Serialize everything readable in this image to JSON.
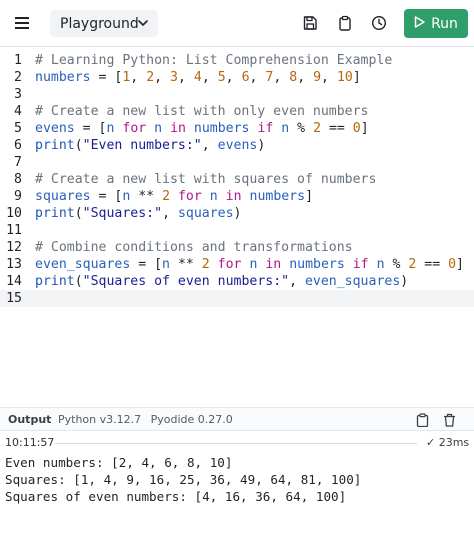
{
  "toolbar": {
    "menu_icon": "hamburger-menu-icon",
    "file_label": "Playground",
    "run_label": "Run",
    "colors": {
      "run_button": "#2f9e6a",
      "run_text": "#ffffff"
    }
  },
  "editor": {
    "lines": [
      {
        "n": "1",
        "tokens": [
          {
            "t": "# Learning Python: List Comprehension Example",
            "c": "comment"
          }
        ]
      },
      {
        "n": "2",
        "tokens": [
          {
            "t": "numbers",
            "c": "var"
          },
          {
            "t": " = [",
            "c": "op"
          },
          {
            "t": "1",
            "c": "num"
          },
          {
            "t": ", ",
            "c": "op"
          },
          {
            "t": "2",
            "c": "num"
          },
          {
            "t": ", ",
            "c": "op"
          },
          {
            "t": "3",
            "c": "num"
          },
          {
            "t": ", ",
            "c": "op"
          },
          {
            "t": "4",
            "c": "num"
          },
          {
            "t": ", ",
            "c": "op"
          },
          {
            "t": "5",
            "c": "num"
          },
          {
            "t": ", ",
            "c": "op"
          },
          {
            "t": "6",
            "c": "num"
          },
          {
            "t": ", ",
            "c": "op"
          },
          {
            "t": "7",
            "c": "num"
          },
          {
            "t": ", ",
            "c": "op"
          },
          {
            "t": "8",
            "c": "num"
          },
          {
            "t": ", ",
            "c": "op"
          },
          {
            "t": "9",
            "c": "num"
          },
          {
            "t": ", ",
            "c": "op"
          },
          {
            "t": "10",
            "c": "num"
          },
          {
            "t": "]",
            "c": "op"
          }
        ]
      },
      {
        "n": "3",
        "tokens": []
      },
      {
        "n": "4",
        "tokens": [
          {
            "t": "# Create a new list with only even numbers",
            "c": "comment"
          }
        ]
      },
      {
        "n": "5",
        "tokens": [
          {
            "t": "evens",
            "c": "var"
          },
          {
            "t": " = [",
            "c": "op"
          },
          {
            "t": "n",
            "c": "var"
          },
          {
            "t": " ",
            "c": "op"
          },
          {
            "t": "for",
            "c": "kw"
          },
          {
            "t": " ",
            "c": "op"
          },
          {
            "t": "n",
            "c": "var"
          },
          {
            "t": " ",
            "c": "op"
          },
          {
            "t": "in",
            "c": "kw"
          },
          {
            "t": " ",
            "c": "op"
          },
          {
            "t": "numbers",
            "c": "var"
          },
          {
            "t": " ",
            "c": "op"
          },
          {
            "t": "if",
            "c": "kw"
          },
          {
            "t": " ",
            "c": "op"
          },
          {
            "t": "n",
            "c": "var"
          },
          {
            "t": " % ",
            "c": "op"
          },
          {
            "t": "2",
            "c": "num"
          },
          {
            "t": " == ",
            "c": "op"
          },
          {
            "t": "0",
            "c": "num"
          },
          {
            "t": "]",
            "c": "op"
          }
        ]
      },
      {
        "n": "6",
        "tokens": [
          {
            "t": "print",
            "c": "fn"
          },
          {
            "t": "(",
            "c": "op"
          },
          {
            "t": "\"Even numbers:\"",
            "c": "str"
          },
          {
            "t": ", ",
            "c": "op"
          },
          {
            "t": "evens",
            "c": "var"
          },
          {
            "t": ")",
            "c": "op"
          }
        ]
      },
      {
        "n": "7",
        "tokens": []
      },
      {
        "n": "8",
        "tokens": [
          {
            "t": "# Create a new list with squares of numbers",
            "c": "comment"
          }
        ]
      },
      {
        "n": "9",
        "tokens": [
          {
            "t": "squares",
            "c": "var"
          },
          {
            "t": " = [",
            "c": "op"
          },
          {
            "t": "n",
            "c": "var"
          },
          {
            "t": " ** ",
            "c": "op"
          },
          {
            "t": "2",
            "c": "num"
          },
          {
            "t": " ",
            "c": "op"
          },
          {
            "t": "for",
            "c": "kw"
          },
          {
            "t": " ",
            "c": "op"
          },
          {
            "t": "n",
            "c": "var"
          },
          {
            "t": " ",
            "c": "op"
          },
          {
            "t": "in",
            "c": "kw"
          },
          {
            "t": " ",
            "c": "op"
          },
          {
            "t": "numbers",
            "c": "var"
          },
          {
            "t": "]",
            "c": "op"
          }
        ]
      },
      {
        "n": "10",
        "tokens": [
          {
            "t": "print",
            "c": "fn"
          },
          {
            "t": "(",
            "c": "op"
          },
          {
            "t": "\"Squares:\"",
            "c": "str"
          },
          {
            "t": ", ",
            "c": "op"
          },
          {
            "t": "squares",
            "c": "var"
          },
          {
            "t": ")",
            "c": "op"
          }
        ]
      },
      {
        "n": "11",
        "tokens": []
      },
      {
        "n": "12",
        "tokens": [
          {
            "t": "# Combine conditions and transformations",
            "c": "comment"
          }
        ]
      },
      {
        "n": "13",
        "tokens": [
          {
            "t": "even_squares",
            "c": "var"
          },
          {
            "t": " = [",
            "c": "op"
          },
          {
            "t": "n",
            "c": "var"
          },
          {
            "t": " ** ",
            "c": "op"
          },
          {
            "t": "2",
            "c": "num"
          },
          {
            "t": " ",
            "c": "op"
          },
          {
            "t": "for",
            "c": "kw"
          },
          {
            "t": " ",
            "c": "op"
          },
          {
            "t": "n",
            "c": "var"
          },
          {
            "t": " ",
            "c": "op"
          },
          {
            "t": "in",
            "c": "kw"
          },
          {
            "t": " ",
            "c": "op"
          },
          {
            "t": "numbers",
            "c": "var"
          },
          {
            "t": " ",
            "c": "op"
          },
          {
            "t": "if",
            "c": "kw"
          },
          {
            "t": " ",
            "c": "op"
          },
          {
            "t": "n",
            "c": "var"
          },
          {
            "t": " % ",
            "c": "op"
          },
          {
            "t": "2",
            "c": "num"
          },
          {
            "t": " == ",
            "c": "op"
          },
          {
            "t": "0",
            "c": "num"
          },
          {
            "t": "]",
            "c": "op"
          }
        ]
      },
      {
        "n": "14",
        "tokens": [
          {
            "t": "print",
            "c": "fn"
          },
          {
            "t": "(",
            "c": "op"
          },
          {
            "t": "\"Squares of even numbers:\"",
            "c": "str"
          },
          {
            "t": ", ",
            "c": "op"
          },
          {
            "t": "even_squares",
            "c": "var"
          },
          {
            "t": ")",
            "c": "op"
          }
        ]
      },
      {
        "n": "15",
        "tokens": [],
        "active": true
      }
    ]
  },
  "output": {
    "title": "Output",
    "python_version": "Python v3.12.7",
    "pyodide_version": "Pyodide 0.27.0",
    "copy_icon": "clipboard-icon",
    "clear_icon": "trash-icon",
    "run_time": "10:11:57",
    "duration": "✓ 23ms",
    "lines": [
      "Even numbers: [2, 4, 6, 8, 10]",
      "Squares: [1, 4, 9, 16, 25, 36, 49, 64, 81, 100]",
      "Squares of even numbers: [4, 16, 36, 64, 100]"
    ]
  }
}
